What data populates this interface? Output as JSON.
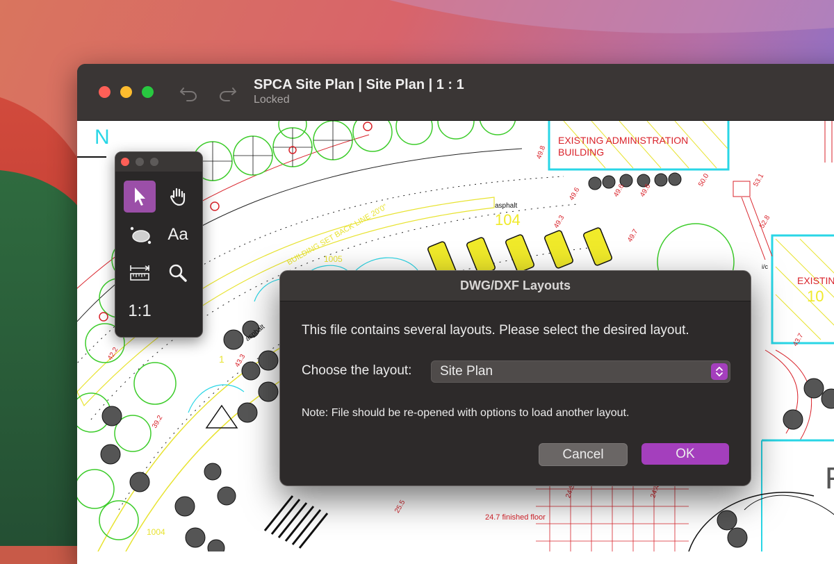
{
  "window": {
    "title": "SPCA Site Plan | Site Plan | 1 : 1",
    "subtitle": "Locked"
  },
  "toolbar": {
    "tools": [
      {
        "name": "select",
        "icon": "arrow-pointer-icon",
        "active": true
      },
      {
        "name": "pan",
        "icon": "hand-icon",
        "active": false
      },
      {
        "name": "shape",
        "icon": "ellipse-shape-icon",
        "active": false
      },
      {
        "name": "text",
        "label": "Aa",
        "active": false
      },
      {
        "name": "measure",
        "icon": "ruler-icon",
        "active": false
      },
      {
        "name": "zoom",
        "icon": "magnifier-icon",
        "active": false
      },
      {
        "name": "actual-size",
        "label": "1:1",
        "active": false
      }
    ]
  },
  "drawing": {
    "labels": {
      "north": "N",
      "admin_building_1": "EXISTING ADMINISTRATION",
      "admin_building_2": "BUILDING",
      "asphalt_1": "asphalt",
      "asphalt_2": "asphalt",
      "num_104": "104",
      "num_1005": "1005",
      "num_1004": "1004",
      "existing_right": "EXISTING",
      "existing_right_num": "10",
      "setback": "BUILDING SET BACK LINE 20'0\"",
      "finished_floor": "24.7 finished floor",
      "triangle_num": "1",
      "ic": "i/c",
      "r_letter": "F"
    },
    "elevations": [
      "49.8",
      "49.6",
      "49.6",
      "49.6",
      "50.0",
      "53.1",
      "52.8",
      "49.3",
      "49.7",
      "43.7",
      "42.2",
      "43.3",
      "39.2",
      "25.5",
      "24.3",
      "24.4"
    ]
  },
  "dialog": {
    "title": "DWG/DXF Layouts",
    "message": "This file contains several layouts. Please select the desired layout.",
    "choose_label": "Choose the layout:",
    "selected_layout": "Site Plan",
    "note": "Note: File should be re-opened with options to load another layout.",
    "cancel_label": "Cancel",
    "ok_label": "OK"
  },
  "colors": {
    "accent": "#a43fbd",
    "cad_red": "#d9222a",
    "cad_green": "#3ccc2a",
    "cad_yellow": "#e8e330",
    "cad_cyan": "#29d6e6"
  }
}
